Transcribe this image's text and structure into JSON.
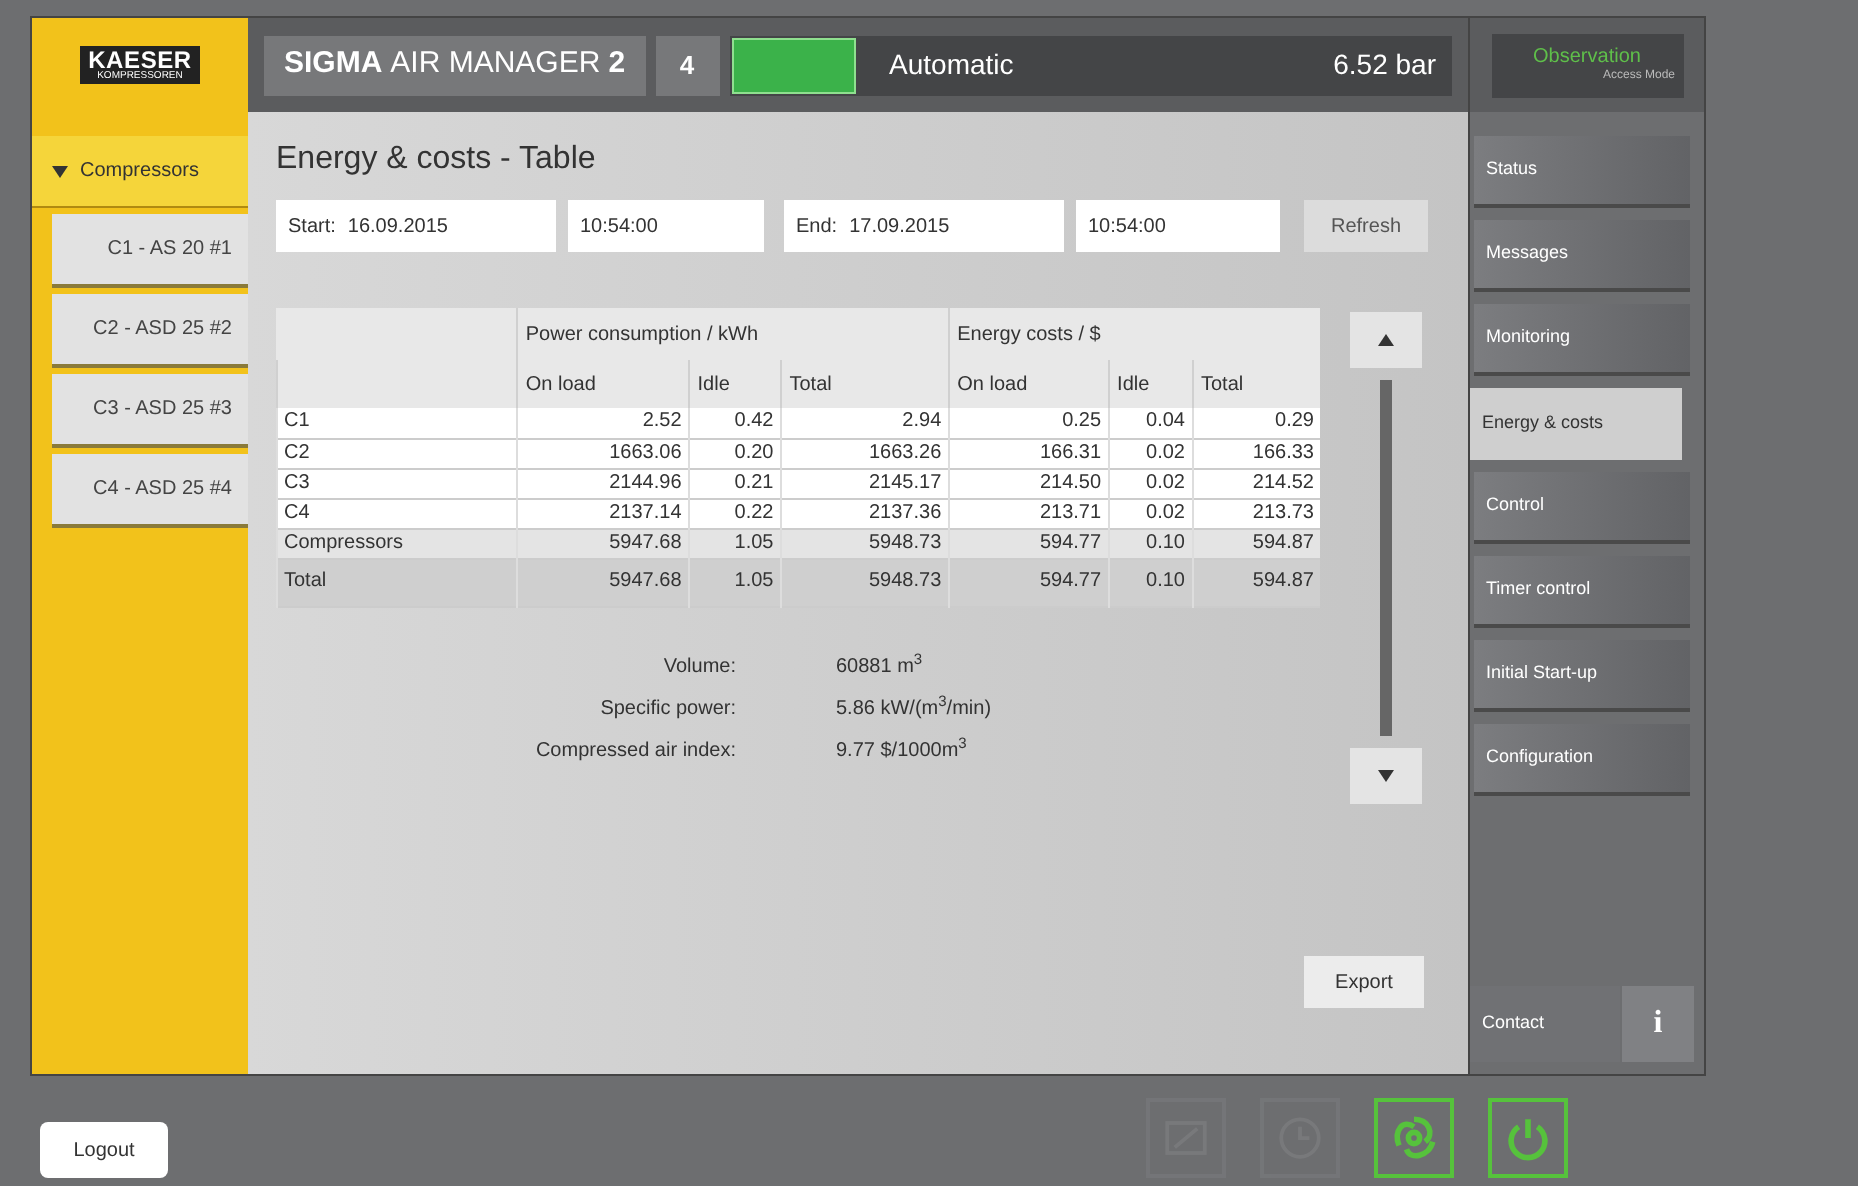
{
  "logo": {
    "line1": "KAESER",
    "line2": "KOMPRESSOREN"
  },
  "header": {
    "product": "SIGMA",
    "product_rest": "AIR MANAGER",
    "product_version": "2",
    "station": "4",
    "status_on": true,
    "mode": "Automatic",
    "pressure": "6.52 bar"
  },
  "access": {
    "mode": "Observation",
    "caption": "Access Mode"
  },
  "sidebar": {
    "group": {
      "label": "Compressors",
      "expanded": true,
      "selected": true
    },
    "items": [
      {
        "label": "C1 - AS 20 #1",
        "selected": false
      },
      {
        "label": "C2 - ASD 25 #2",
        "selected": false
      },
      {
        "label": "C3 - ASD 25 #3",
        "selected": false
      },
      {
        "label": "C4 - ASD 25 #4",
        "selected": false
      }
    ]
  },
  "page": {
    "title": "Energy & costs - Table",
    "start_label": "Start:",
    "start_date": "16.09.2015",
    "start_time": "10:54:00",
    "end_label": "End:",
    "end_date": "17.09.2015",
    "end_time": "10:54:00",
    "refresh": "Refresh",
    "export": "Export"
  },
  "table": {
    "groups": [
      "Power consumption / kWh",
      "Energy costs / $"
    ],
    "columns": [
      "",
      "On load",
      "Idle",
      "Total",
      "On load",
      "Idle",
      "Total"
    ],
    "rows": [
      {
        "kind": "unit",
        "cells": [
          "C1",
          "2.52",
          "0.42",
          "2.94",
          "0.25",
          "0.04",
          "0.29"
        ]
      },
      {
        "kind": "unit",
        "cells": [
          "C2",
          "1663.06",
          "0.20",
          "1663.26",
          "166.31",
          "0.02",
          "166.33"
        ]
      },
      {
        "kind": "unit",
        "cells": [
          "C3",
          "2144.96",
          "0.21",
          "2145.17",
          "214.50",
          "0.02",
          "214.52"
        ]
      },
      {
        "kind": "unit",
        "cells": [
          "C4",
          "2137.14",
          "0.22",
          "2137.36",
          "213.71",
          "0.02",
          "213.73"
        ]
      },
      {
        "kind": "subtotal",
        "cells": [
          "Compressors",
          "5947.68",
          "1.05",
          "5948.73",
          "594.77",
          "0.10",
          "594.87"
        ]
      },
      {
        "kind": "total",
        "cells": [
          "Total",
          "5947.68",
          "1.05",
          "5948.73",
          "594.77",
          "0.10",
          "594.87"
        ]
      }
    ]
  },
  "summary": [
    {
      "label": "Volume:",
      "value": "60881 m$^{3}$"
    },
    {
      "label": "Specific power:",
      "value": "5.86 kW/(m$^{3}$/min)"
    },
    {
      "label": "Compressed air index:",
      "value": "9.77 $/1000m$^{3}$"
    }
  ],
  "nav": [
    {
      "label": "Status",
      "selected": false
    },
    {
      "label": "Messages",
      "selected": false
    },
    {
      "label": "Monitoring",
      "selected": false
    },
    {
      "label": "Energy & costs",
      "selected": true
    },
    {
      "label": "Control",
      "selected": false
    },
    {
      "label": "Timer control",
      "selected": false
    },
    {
      "label": "Initial Start-up",
      "selected": false
    },
    {
      "label": "Configuration",
      "selected": false
    }
  ],
  "contact": "Contact",
  "info": "i",
  "footer": {
    "logout": "Logout",
    "tools": [
      {
        "kind": "image",
        "on": false
      },
      {
        "kind": "clock",
        "on": false
      },
      {
        "kind": "swirl",
        "on": true
      },
      {
        "kind": "power",
        "on": true
      }
    ]
  }
}
